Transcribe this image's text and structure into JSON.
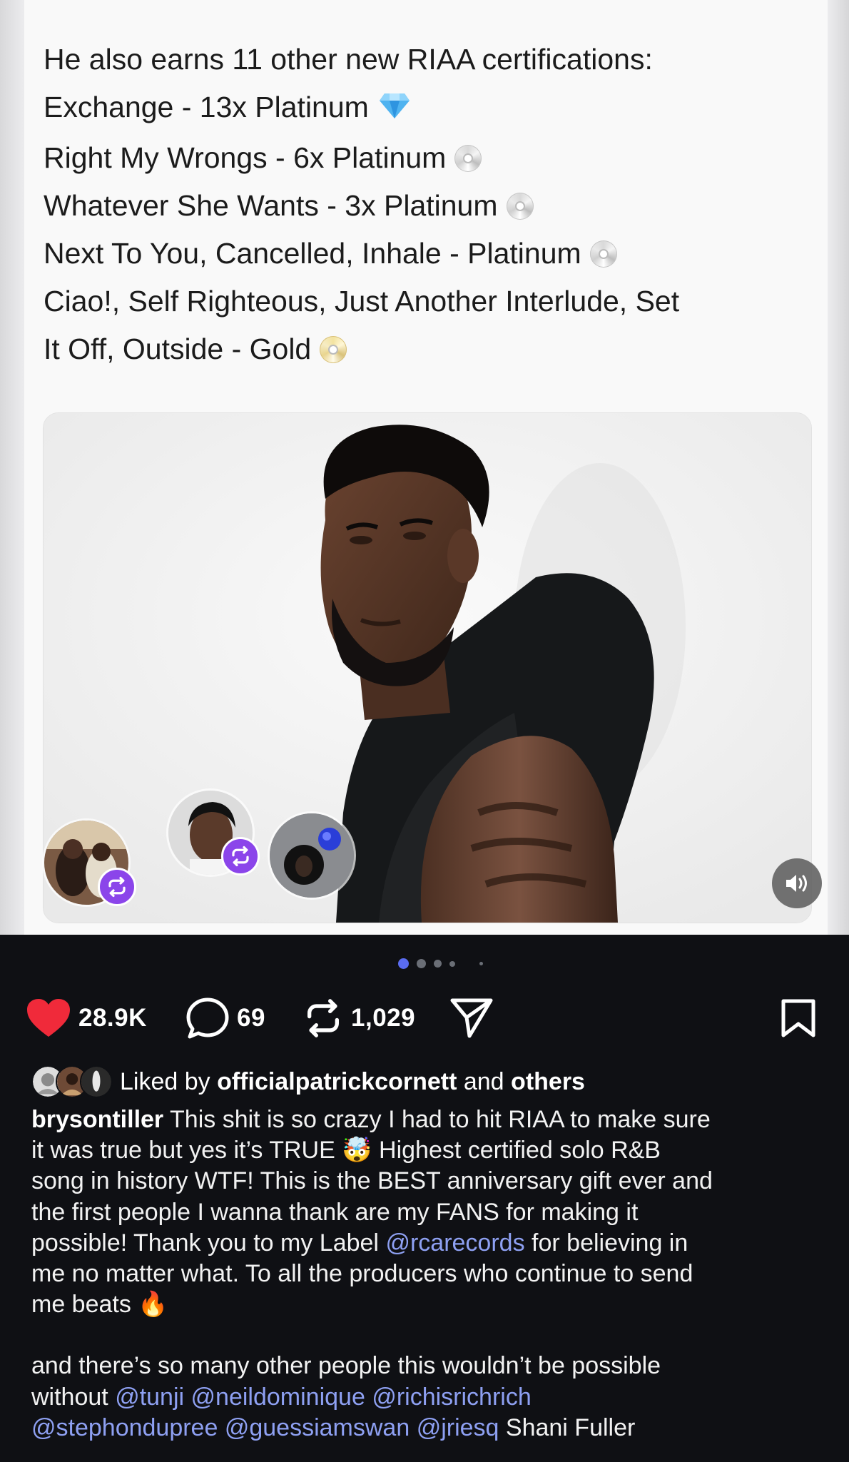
{
  "post_image": {
    "cert_lines": [
      {
        "text": "He also earns 11 other new RIAA certifications:",
        "badge": "none"
      },
      {
        "text": "Exchange - 13x Platinum",
        "badge": "diamond-icon"
      },
      {
        "text": "Right My Wrongs - 6x Platinum",
        "badge": "platinum-disc-icon"
      },
      {
        "text": "Whatever She Wants - 3x Platinum",
        "badge": "platinum-disc-icon"
      },
      {
        "text": "Next To You, Cancelled, Inhale - Platinum",
        "badge": "platinum-disc-icon"
      },
      {
        "text": "Ciao!, Self Righteous, Just Another Interlude, Set",
        "badge": "none"
      },
      {
        "text": "It Off, Outside - Gold",
        "badge": "gold-disc-icon"
      }
    ],
    "carousel": {
      "total": 5,
      "active_index": 0
    }
  },
  "actions": {
    "likes": "28.9K",
    "comments": "69",
    "reposts": "1,029"
  },
  "liked_by": {
    "prefix": "Liked by",
    "user": "officialpatrickcornett",
    "joiner": "and",
    "others": "others"
  },
  "caption": {
    "username": "brysontiller",
    "lines": {
      "l1": "This shit is so crazy I had to hit RIAA to make sure",
      "l2a": "it was true but yes it’s TRUE",
      "l2b": "Highest certified solo R&B",
      "l3": "song in history WTF! This is the BEST anniversary gift ever and",
      "l4": "the first people I wanna thank are my FANS for making it",
      "l5a": "possible! Thank you to my Label",
      "l5m": "@rcarecords",
      "l5b": "for believing in",
      "l6": "me no matter what. To all the producers who continue to send",
      "l7": "me beats",
      "l8": "and there’s so many other people this wouldn’t be possible",
      "l9a": "without",
      "l9m1": "@tunji",
      "l9m2": "@neildominique",
      "l9m3": "@richisrichrich",
      "l10m1": "@stephondupree",
      "l10m2": "@guessiamswan",
      "l10m3": "@jriesq",
      "l10b": "Shani Fuller"
    },
    "emoji": {
      "mindblown": "🤯",
      "fire": "🔥"
    }
  },
  "colors": {
    "background": "#0f1014",
    "like_red": "#f02a3a",
    "mention_blue": "#8ea0f2",
    "repost_purple": "#8b45ea",
    "active_dot": "#5a6cf0"
  }
}
